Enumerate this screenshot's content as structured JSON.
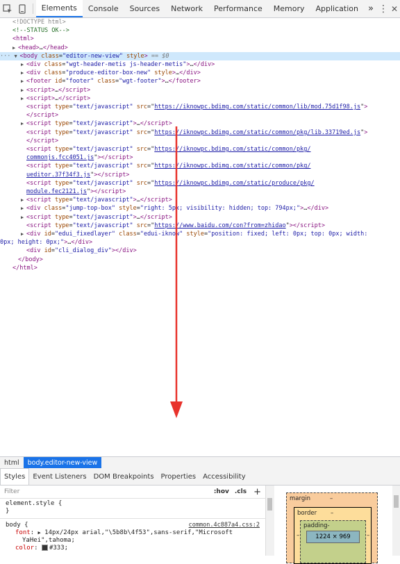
{
  "toolbar": {
    "tabs": [
      {
        "label": "Elements"
      },
      {
        "label": "Console"
      },
      {
        "label": "Sources"
      },
      {
        "label": "Network"
      },
      {
        "label": "Performance"
      },
      {
        "label": "Memory"
      },
      {
        "label": "Application"
      }
    ],
    "more_label": "»",
    "menu_label": "⋮",
    "close_label": "✕"
  },
  "dom": {
    "doctype": "<!DOCTYPE html>",
    "comment": "<!--STATUS OK-->",
    "html_open": "html",
    "head_open": "head",
    "head_ellipsis": "…",
    "head_close": "</head>",
    "body_tag": "body",
    "body_class_attr": "class",
    "body_class_val": "\"editor-new-view\"",
    "body_style_attr": "style",
    "body_selected_marker": "== $0",
    "ellipsis": "…",
    "div1_class": "\"wgt-header-metis js-header-metis\"",
    "div2_class": "\"produce-editor-box-new\"",
    "footer_id": "\"footer\"",
    "footer_class": "\"wgt-footer\"",
    "script_type_js": "\"text/javascript\"",
    "src1": "https://iknowpc.bdimg.com/static/common/lib/mod.75d1f98.js",
    "src2": "https://iknowpc.bdimg.com/static/common/pkg/lib.33719ed.js",
    "src3a": "https://iknowpc.bdimg.com/static/common/pkg/",
    "src3b": "commonjs.fcc4051.js",
    "src4a": "https://iknowpc.bdimg.com/static/common/pkg/",
    "src4b": "ueditor.37f34f3.js",
    "src5a": "https://iknowpc.bdimg.com/static/produce/pkg/",
    "src5b": "module.fec2121.js",
    "jump_class": "\"jump-top-box\"",
    "jump_style": "\"right: 5px; visibility: hidden; top: 794px;\"",
    "src6": "https://www.baidu.com/con?from=zhidao",
    "edui_id": "\"edui_fixedlayer\"",
    "edui_class": "\"edui-iknow\"",
    "edui_style_a": "\"position: fixed; left: 0px; top: 0px; width:",
    "edui_style_b": "0px; height: 0px;\"",
    "cli_id": "\"cli_dialog_div\"",
    "body_close": "</body>",
    "html_close": "</html>"
  },
  "breadcrumbs": [
    {
      "label": "html"
    },
    {
      "label": "body.editor-new-view"
    }
  ],
  "panel_tabs": [
    {
      "label": "Styles"
    },
    {
      "label": "Event Listeners"
    },
    {
      "label": "DOM Breakpoints"
    },
    {
      "label": "Properties"
    },
    {
      "label": "Accessibility"
    }
  ],
  "styles": {
    "filter_placeholder": "Filter",
    "hov": ":hov",
    "cls": ".cls",
    "plus": "+",
    "element_style": "element.style {",
    "close_brace": "}",
    "body_selector": "body {",
    "body_source": "common.4c887a4.css:2",
    "font_name": "font",
    "font_value_a": "14px/24px arial,\"\\5b8b\\4f53\",sans-serif,\"Microsoft",
    "font_value_b": "YaHei\",tahoma;",
    "color_name": "color",
    "color_value": "#333;"
  },
  "box_model": {
    "margin_label": "margin",
    "border_label": "border",
    "padding_label": "padding-",
    "dash": "–",
    "content_size": "1224 × 969"
  },
  "annotation": {
    "arrow_color": "#e8322b"
  }
}
